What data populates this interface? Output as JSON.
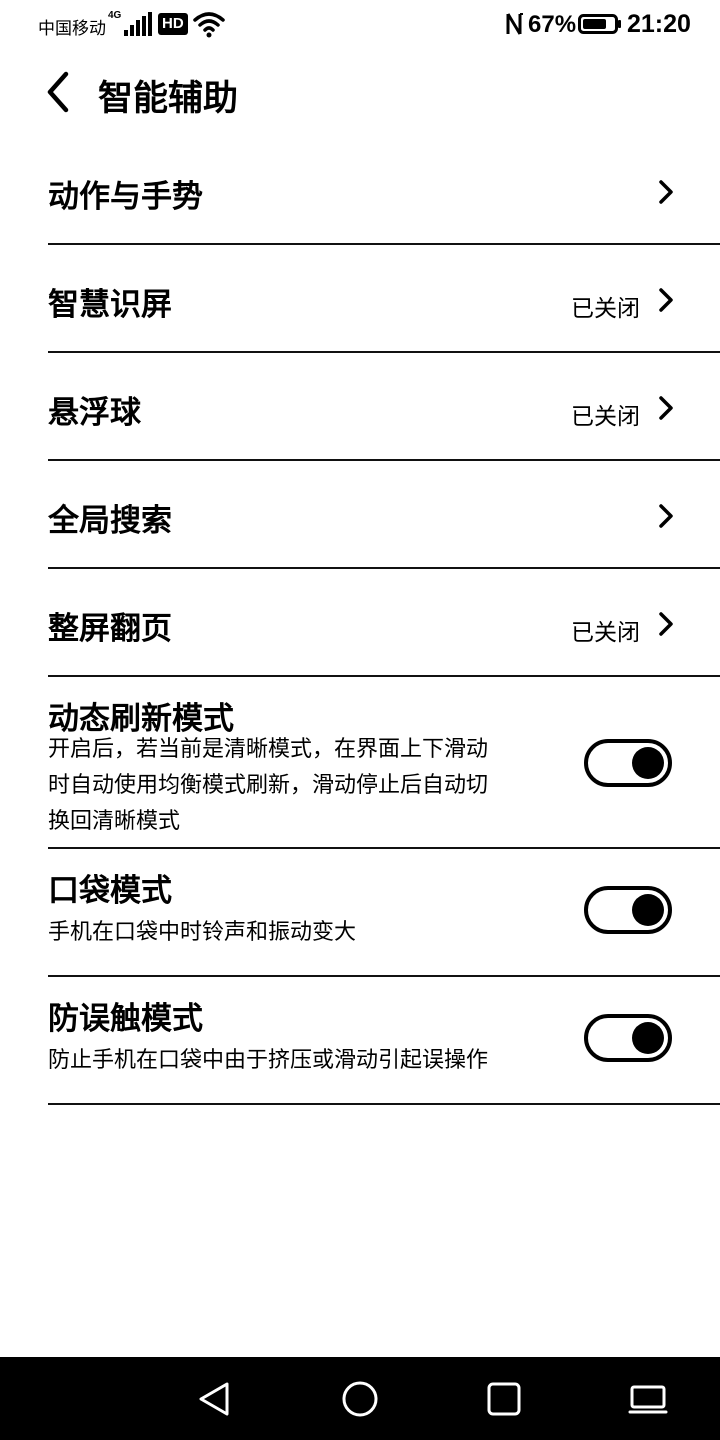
{
  "status_bar": {
    "carrier": "中国移动",
    "network_type": "4G",
    "hd": "HD",
    "battery_percent": "67%",
    "time": "21:20"
  },
  "header": {
    "title": "智能辅助"
  },
  "nav_items": [
    {
      "label": "动作与手势",
      "status": ""
    },
    {
      "label": "智慧识屏",
      "status": "已关闭"
    },
    {
      "label": "悬浮球",
      "status": "已关闭"
    },
    {
      "label": "全局搜索",
      "status": ""
    },
    {
      "label": "整屏翻页",
      "status": "已关闭"
    }
  ],
  "toggle_items": [
    {
      "label": "动态刷新模式",
      "desc_lines": [
        "开启后，若当前是清晰模式，在界面上下滑动",
        "时自动使用均衡模式刷新，滑动停止后自动切",
        "换回清晰模式"
      ],
      "on": true
    },
    {
      "label": "口袋模式",
      "desc_lines": [
        "手机在口袋中时铃声和振动变大"
      ],
      "on": true
    },
    {
      "label": "防误触模式",
      "desc_lines": [
        "防止手机在口袋中由于挤压或滑动引起误操作"
      ],
      "on": true
    }
  ]
}
